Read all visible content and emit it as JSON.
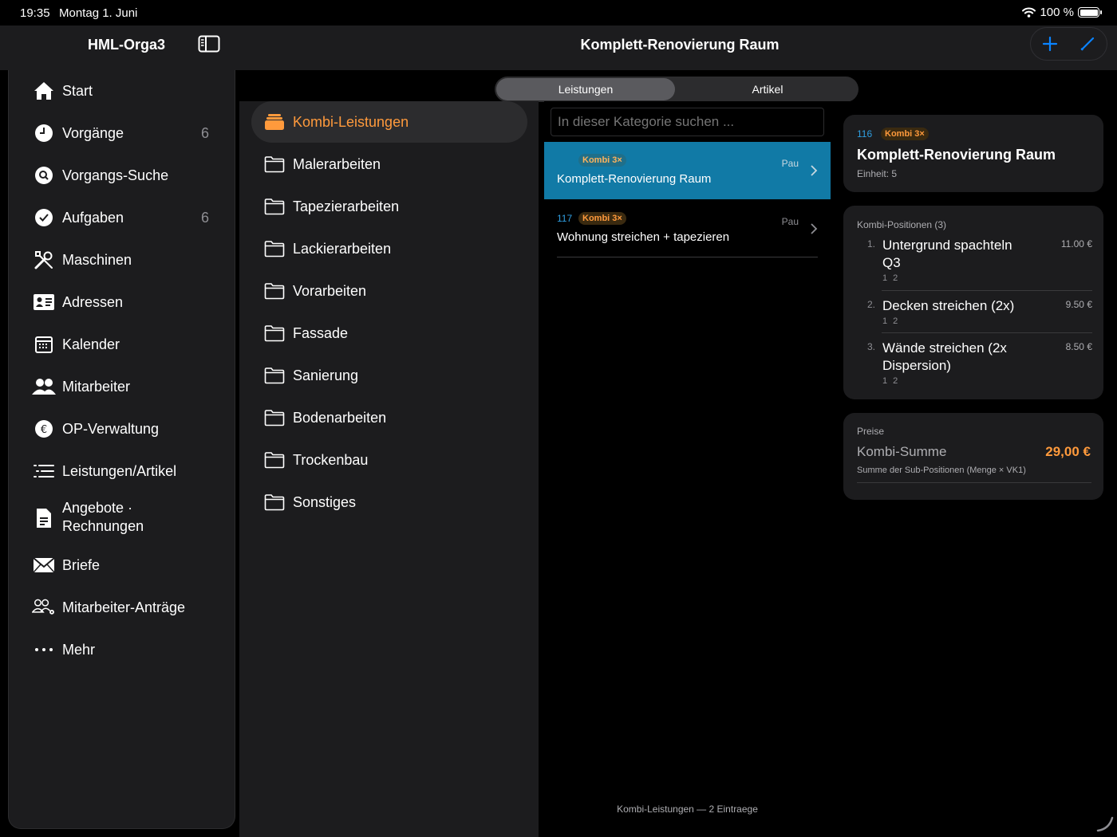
{
  "status": {
    "time": "19:35",
    "date": "Montag 1. Juni",
    "battery": "100 %"
  },
  "header": {
    "app_title": "HML-Orga3",
    "page_title": "Komplett-Renovierung Raum"
  },
  "sidebar": {
    "items": [
      {
        "label": "Start",
        "icon": "house-icon",
        "count": ""
      },
      {
        "label": "Vorgänge",
        "icon": "clock-icon",
        "count": "6"
      },
      {
        "label": "Vorgangs-Suche",
        "icon": "search-icon",
        "count": ""
      },
      {
        "label": "Aufgaben",
        "icon": "checkmark-icon",
        "count": "6"
      },
      {
        "label": "Maschinen",
        "icon": "tools-icon",
        "count": ""
      },
      {
        "label": "Adressen",
        "icon": "contact-card-icon",
        "count": ""
      },
      {
        "label": "Kalender",
        "icon": "calendar-icon",
        "count": ""
      },
      {
        "label": "Mitarbeiter",
        "icon": "people-icon",
        "count": ""
      },
      {
        "label": "OP-Verwaltung",
        "icon": "euro-icon",
        "count": ""
      },
      {
        "label": "Leistungen/Artikel",
        "icon": "list-icon",
        "count": ""
      },
      {
        "label": "Angebote ·",
        "label2": "Rechnungen",
        "icon": "document-icon",
        "count": ""
      },
      {
        "label": "Briefe",
        "icon": "envelope-icon",
        "count": ""
      },
      {
        "label": "Mitarbeiter-Anträge",
        "icon": "people-gear-icon",
        "count": ""
      },
      {
        "label": "Mehr",
        "icon": "more-icon",
        "count": ""
      }
    ]
  },
  "tabs": {
    "leistungen": "Leistungen",
    "artikel": "Artikel"
  },
  "categories": [
    {
      "label": "Kombi-Leistungen",
      "active": true
    },
    {
      "label": "Malerarbeiten"
    },
    {
      "label": "Tapezierarbeiten"
    },
    {
      "label": "Lackierarbeiten"
    },
    {
      "label": "Vorarbeiten"
    },
    {
      "label": "Fassade"
    },
    {
      "label": "Sanierung"
    },
    {
      "label": "Bodenarbeiten"
    },
    {
      "label": "Trockenbau"
    },
    {
      "label": "Sonstiges"
    }
  ],
  "list": {
    "search_placeholder": "In dieser Kategorie suchen ...",
    "items": [
      {
        "number": "116",
        "badge": "Kombi 3×",
        "name": "Komplett-Renovierung Raum",
        "unit": "Pau",
        "selected": true
      },
      {
        "number": "117",
        "badge": "Kombi 3×",
        "name": "Wohnung streichen + tapezieren",
        "unit": "Pau"
      }
    ],
    "footer": "Kombi-Leistungen — 2 Eintraege"
  },
  "detail": {
    "number": "116",
    "badge": "Kombi 3×",
    "title": "Komplett-Renovierung Raum",
    "einheit": "Einheit: 5",
    "positions_header": "Kombi-Positionen (3)",
    "positions": [
      {
        "num": "1.",
        "name": "Untergrund spachteln Q3",
        "price": "11.00 €",
        "qty": "1 2"
      },
      {
        "num": "2.",
        "name": "Decken streichen (2x)",
        "price": "9.50 €",
        "qty": "1 2"
      },
      {
        "num": "3.",
        "name": "Wände streichen (2x Dispersion)",
        "price": "8.50 €",
        "qty": "1 2"
      }
    ],
    "prices_header": "Preise",
    "sum_label": "Kombi-Summe",
    "sum_value": "29,00 €",
    "sum_note": "Summe der Sub-Positionen (Menge × VK1)"
  },
  "colors": {
    "accent_orange": "#ff9a3c",
    "accent_blue": "#2f9ee0",
    "selected_row": "#117aa6"
  }
}
